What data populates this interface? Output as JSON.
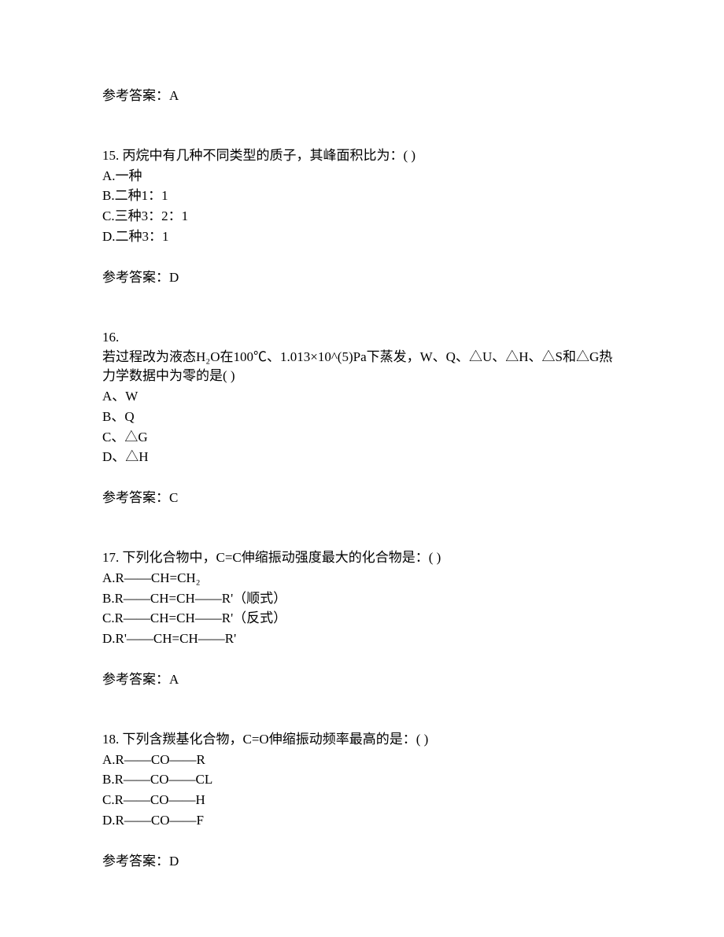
{
  "prev_answer": {
    "label": "参考答案：A"
  },
  "q15": {
    "number": "15. 丙烷中有几种不同类型的质子，其峰面积比为：(  )",
    "optA": "A.一种",
    "optB": "B.二种1：1",
    "optC": "C.三种3：2：1",
    "optD": "D.二种3：1",
    "answer": "参考答案：D"
  },
  "q16": {
    "number": "16.",
    "text": "若过程改为液态H₂O在100℃、1.013×10^(5)Pa下蒸发，W、Q、△U、△H、△S和△G热力学数据中为零的是(  )",
    "optA": "A、W",
    "optB": "B、Q",
    "optC": "C、△G",
    "optD": "D、△H",
    "answer": "参考答案：C"
  },
  "q17": {
    "number": "17. 下列化合物中，C=C伸缩振动强度最大的化合物是：(  )",
    "optA": "A.R——CH=CH₂",
    "optB": "B.R——CH=CH——R'（顺式）",
    "optC": "C.R——CH=CH——R'（反式）",
    "optD": "D.R'——CH=CH——R'",
    "answer": "参考答案：A"
  },
  "q18": {
    "number": "18. 下列含羰基化合物，C=O伸缩振动频率最高的是：(  )",
    "optA": "A.R——CO——R",
    "optB": "B.R——CO——CL",
    "optC": "C.R——CO——H",
    "optD": "D.R——CO——F",
    "answer": "参考答案：D"
  }
}
